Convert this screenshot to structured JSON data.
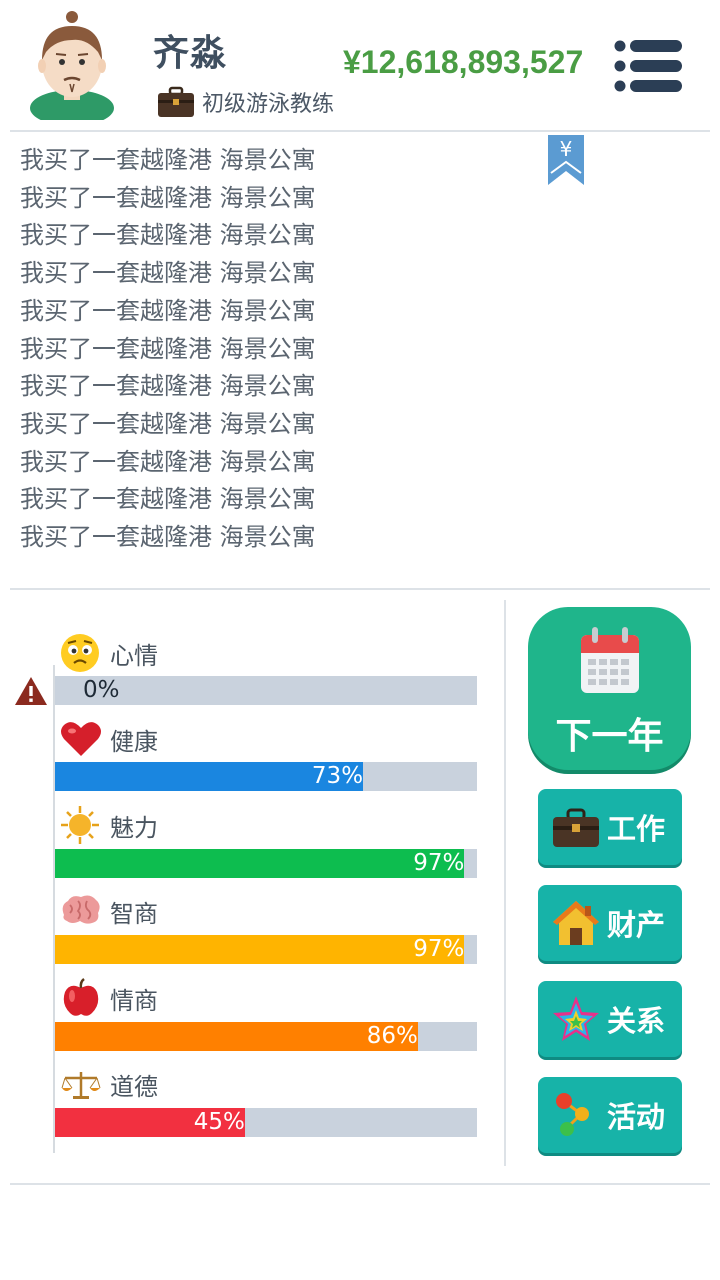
{
  "player": {
    "name": "齐淼",
    "job": "初级游泳教练",
    "money": "¥12,618,893,527"
  },
  "log": [
    "我买了一套越隆港 海景公寓",
    "我买了一套越隆港 海景公寓",
    "我买了一套越隆港 海景公寓",
    "我买了一套越隆港 海景公寓",
    "我买了一套越隆港 海景公寓",
    "我买了一套越隆港 海景公寓",
    "我买了一套越隆港 海景公寓",
    "我买了一套越隆港 海景公寓",
    "我买了一套越隆港 海景公寓",
    "我买了一套越隆港 海景公寓",
    "我买了一套越隆港 海景公寓"
  ],
  "bookmark_symbol": "¥",
  "stats": [
    {
      "label": "心情",
      "value": 0,
      "text": "0%",
      "color": "#c9d2dd",
      "icon": "worried-face-icon"
    },
    {
      "label": "健康",
      "value": 73,
      "text": "73%",
      "color": "#1a86e0",
      "icon": "heart-icon"
    },
    {
      "label": "魅力",
      "value": 97,
      "text": "97%",
      "color": "#0dbd4f",
      "icon": "sun-icon"
    },
    {
      "label": "智商",
      "value": 97,
      "text": "97%",
      "color": "#ffb400",
      "icon": "brain-icon"
    },
    {
      "label": "情商",
      "value": 86,
      "text": "86%",
      "color": "#ff8000",
      "icon": "apple-icon"
    },
    {
      "label": "道德",
      "value": 45,
      "text": "45%",
      "color": "#f23040",
      "icon": "scales-icon"
    }
  ],
  "buttons": {
    "next_year": "下一年",
    "work": "工作",
    "property": "财产",
    "relations": "关系",
    "activities": "活动"
  },
  "colors": {
    "money": "#4a9d44",
    "next_year_bg": "#1fb58b",
    "side_button_bg": "#17b3a8",
    "warning": "#8b2a1f"
  }
}
